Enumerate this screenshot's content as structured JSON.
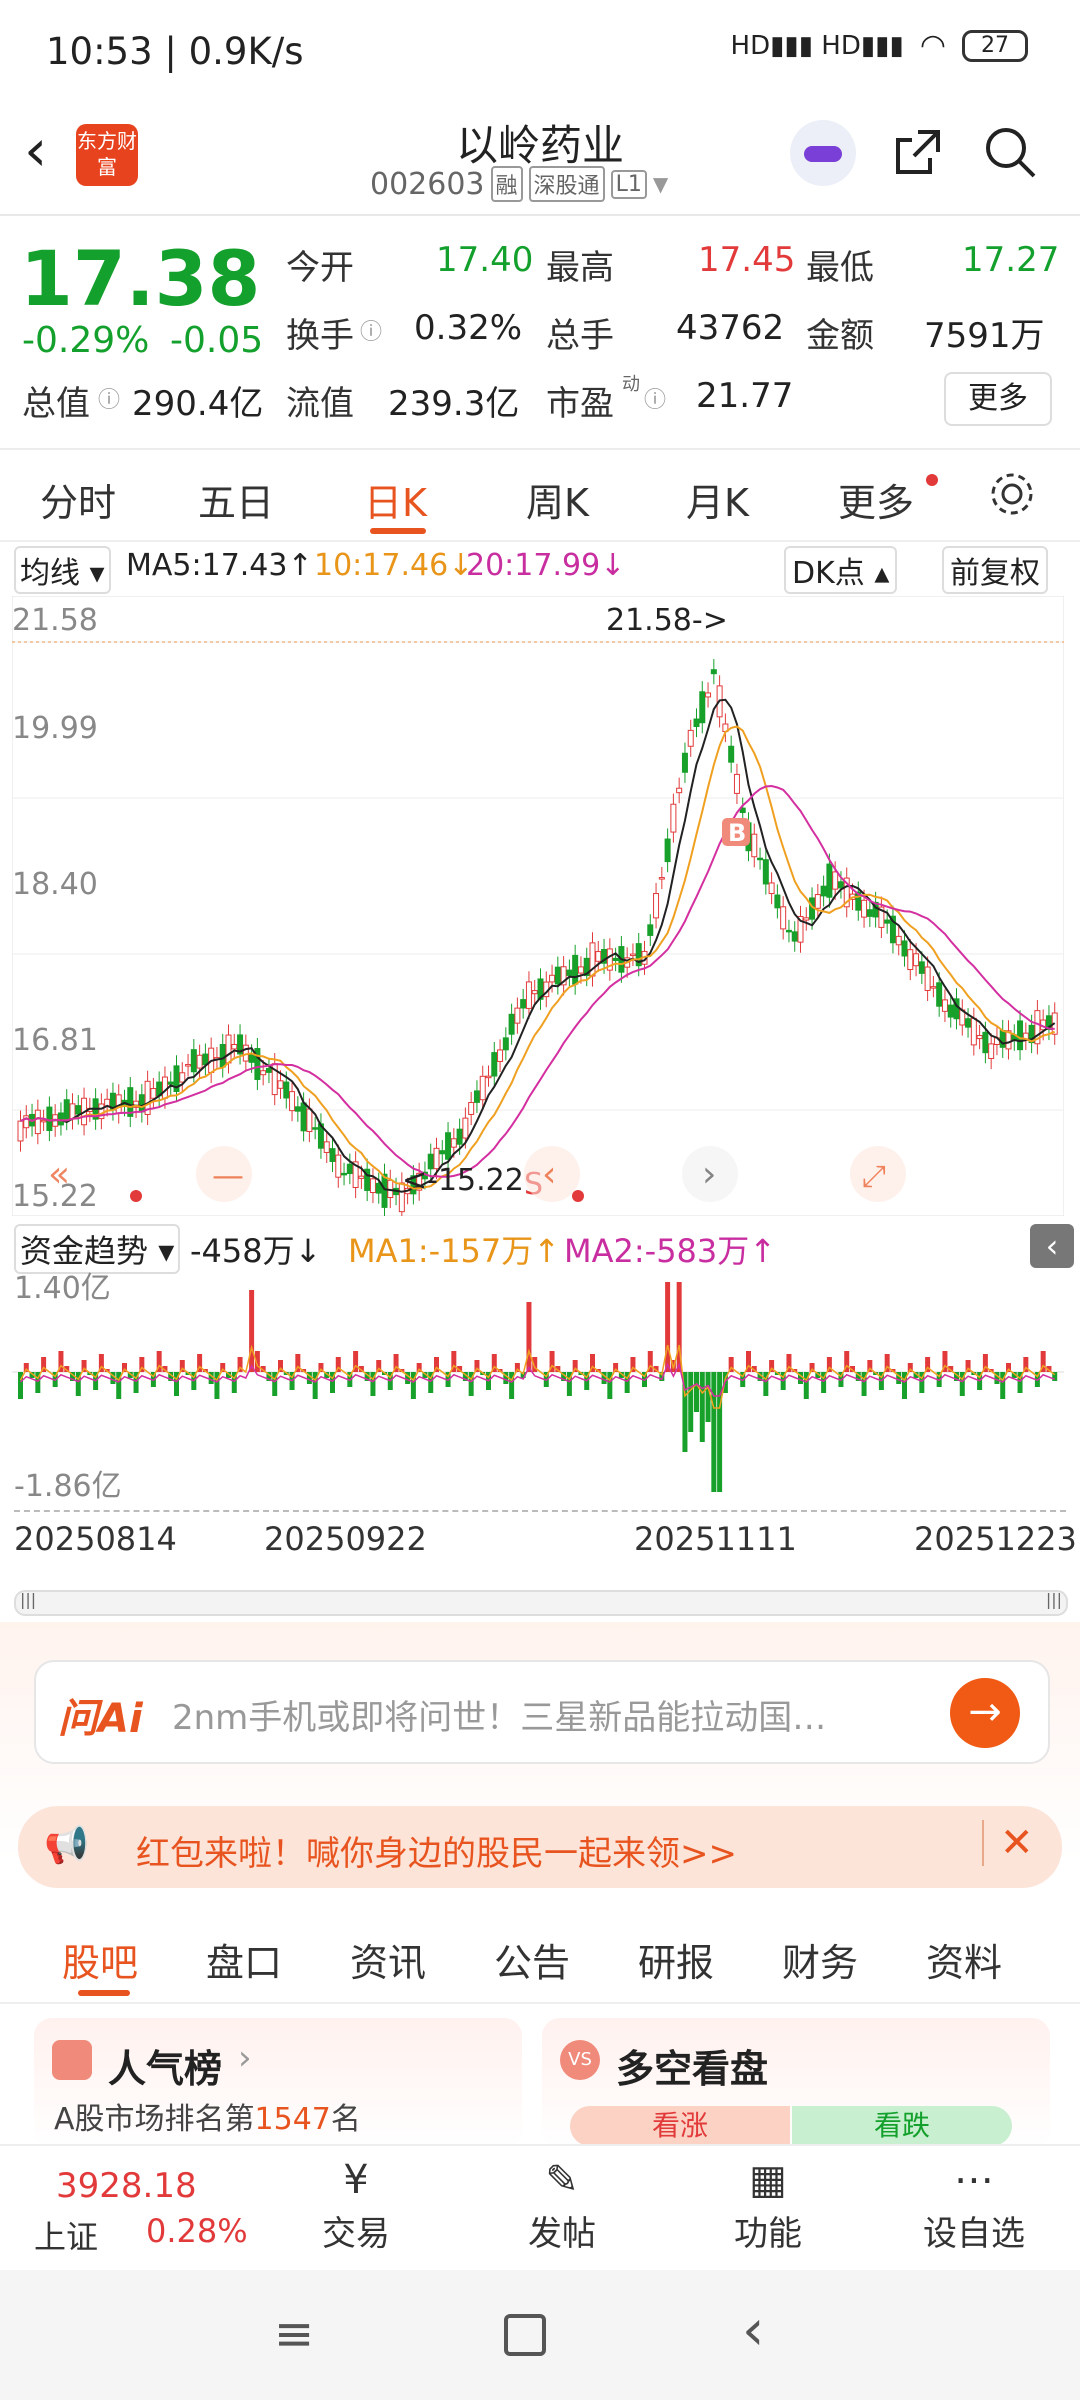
{
  "status": {
    "time": "10:53 | 0.9K/s",
    "battery": "27"
  },
  "header": {
    "title": "以岭药业",
    "code": "002603",
    "tags": [
      "融",
      "深股通",
      "L1"
    ],
    "logo": "东方财富"
  },
  "quote": {
    "price": "17.38",
    "pct": "-0.29%",
    "chg": "-0.05",
    "open_label": "今开",
    "open": "17.40",
    "high_label": "最高",
    "high": "17.45",
    "low_label": "最低",
    "low": "17.27",
    "turn_label": "换手",
    "turn": "0.32%",
    "vol_label": "总手",
    "vol": "43762",
    "amt_label": "金额",
    "amt": "7591万",
    "mcap_label": "总值",
    "mcap": "290.4亿",
    "float_label": "流值",
    "float": "239.3亿",
    "pe_label": "市盈",
    "pe_sup": "动",
    "pe": "21.77",
    "more": "更多"
  },
  "tabs": [
    "分时",
    "五日",
    "日K",
    "周K",
    "月K",
    "更多"
  ],
  "active_tab": "日K",
  "ma": {
    "sel": "均线",
    "ma5": "MA5:17.43↑",
    "ma10": "10:17.46↓",
    "ma20": "20:17.99↓",
    "dk": "DK点",
    "fq": "前复权"
  },
  "chart": {
    "y_labels": [
      "21.58",
      "19.99",
      "18.40",
      "16.81",
      "15.22"
    ],
    "high_mark": "21.58->",
    "low_mark": "<-15.22",
    "b_mark": "B",
    "s_mark": "S",
    "colors": {
      "up": "#e23a3a",
      "down": "#17a02a",
      "ma5": "#222222",
      "ma10": "#f0a020",
      "ma20": "#d42fa0"
    }
  },
  "fund": {
    "sel": "资金趋势",
    "value": "-458万↓",
    "ma1": "MA1:-157万↑",
    "ma2": "MA2:-583万↑",
    "top": "1.40亿",
    "bottom": "-1.86亿"
  },
  "dates": [
    "20250814",
    "20250922",
    "20251111",
    "20251223"
  ],
  "ai": {
    "label": "问Ai",
    "text": "2nm手机或即将问世！三星新品能拉动国…"
  },
  "banner": {
    "text": "红包来啦！喊你身边的股民一起来领>>"
  },
  "btabs": [
    "股吧",
    "盘口",
    "资讯",
    "公告",
    "研报",
    "财务",
    "资料"
  ],
  "cards": {
    "left_title": "人气榜",
    "left_sub_prefix": "A股市场排名第",
    "left_rank": "1547",
    "left_sub_suffix": "名",
    "right_title": "多空看盘",
    "bull": "看涨",
    "bear": "看跌"
  },
  "bottom": {
    "index_value": "3928.18",
    "index_name": "上证",
    "index_pct": "0.28%",
    "trade": "交易",
    "post": "发帖",
    "func": "功能",
    "watch": "设自选"
  }
}
